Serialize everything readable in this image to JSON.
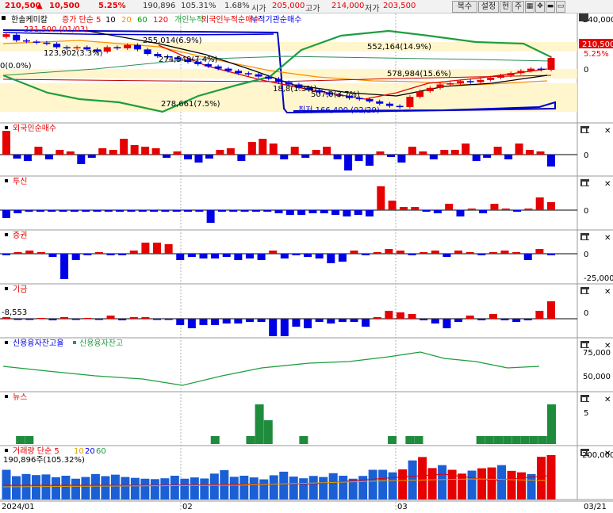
{
  "topbar": {
    "price": "210,500",
    "change_arrow": "▲",
    "change": "10,500",
    "change_pct": "5.25%",
    "volume": "190,896",
    "volume_ratio": "105.31%",
    "turnover": "1.68%",
    "open_label": "시가",
    "open": "205,000",
    "high_label": "고가",
    "high": "214,000",
    "low_label": "저가",
    "low": "203,500",
    "buttons": [
      "복수",
      "설정",
      "현",
      "주"
    ],
    "icon_buttons": [
      "grid-icon",
      "move-icon",
      "minimize-icon",
      "restore-icon"
    ]
  },
  "colors": {
    "up": "#e60000",
    "down": "#0000e6",
    "ma5": "#e60000",
    "ma10": "#000000",
    "ma20": "#ff8c00",
    "ma60": "#006400",
    "ma120": "#2e8b57",
    "bollinger": "#0000cc",
    "retail_cum": "#1e9e3e"
  },
  "main_panel": {
    "legend": [
      {
        "text": "한솔케미칼",
        "color": "#000000"
      },
      {
        "text": "증가 단순 5",
        "color": "#e60000"
      },
      {
        "text": "10",
        "color": "#000000"
      },
      {
        "text": "20",
        "color": "#ff8c00"
      },
      {
        "text": "60",
        "color": "#00a000"
      },
      {
        "text": "120",
        "color": "#e60000"
      },
      {
        "text": "개인누적",
        "color": "#1e9e3e"
      },
      {
        "text": "외국인누적순매수",
        "color": "#e60000"
      },
      {
        "text": "누적기관순매수",
        "color": "#0000e6"
      }
    ],
    "annotations": [
      {
        "text": "231,500 (01/03)",
        "color": "#e60000"
      },
      {
        "text": "123,902(3.3%)",
        "color": "#000000"
      },
      {
        "text": "255,014(6.9%)",
        "color": "#000000"
      },
      {
        "text": "274,549(7.4%)",
        "color": "#000000"
      },
      {
        "text": "278,661(7.5%)",
        "color": "#000000"
      },
      {
        "text": "552,164(14.9%)",
        "color": "#000000"
      },
      {
        "text": "578,984(15.6%)",
        "color": "#000000"
      },
      {
        "text": "507,0(3.7%)",
        "color": "#000000"
      },
      {
        "text": "최저 166,400 (02/29)",
        "color": "#0000e6"
      },
      {
        "text": "18,8(1.3%)",
        "color": "#000000"
      },
      {
        "text": "0(0.0%)",
        "color": "#000000"
      }
    ],
    "axis": {
      "top": "240,000",
      "zero": "0"
    },
    "price_badge": "210,500",
    "price_badge_pct": "5.25%"
  },
  "panels": [
    {
      "title": "외국인순매수",
      "axis": [
        "0"
      ]
    },
    {
      "title": "투신",
      "axis": [
        "0"
      ]
    },
    {
      "title": "증권",
      "axis": [
        "0",
        "-25,000"
      ]
    },
    {
      "title": "기금",
      "axis": [
        "0"
      ],
      "left_value": "-8,553"
    },
    {
      "title": "신용융자잔고율",
      "title2": "신용융자잔고",
      "axis": [
        "75,000",
        "50,000"
      ]
    },
    {
      "title": "뉴스",
      "axis": [
        "5"
      ]
    },
    {
      "title": "거래량 단순 5",
      "title_parts": [
        "10",
        "20",
        "60"
      ],
      "sub": "190,896주(105.32%)",
      "axis": [
        "200,000"
      ]
    }
  ],
  "x_axis": {
    "labels": [
      "2024/01",
      "02",
      "03"
    ],
    "right_label": "03/21"
  },
  "chart_data": {
    "type": "bar",
    "dates_note": "daily sessions, 2024/01 to 03/21",
    "candles": {
      "open": [
        229000,
        231000,
        226000,
        225000,
        224000,
        223000,
        220000,
        219000,
        220000,
        218000,
        216000,
        220000,
        219000,
        222000,
        218000,
        214000,
        212000,
        211000,
        209000,
        207000,
        205000,
        203000,
        201000,
        199000,
        197000,
        196000,
        194000,
        192000,
        189000,
        187000,
        184000,
        182000,
        180000,
        178000,
        177000,
        175000,
        174000,
        172000,
        170000,
        168000,
        167000,
        176000,
        181000,
        184000,
        187000,
        188000,
        190000,
        189000,
        191000,
        193000,
        195000,
        197000,
        199000,
        201000,
        200000
      ],
      "close": [
        231500,
        226000,
        225000,
        224000,
        223000,
        220000,
        219000,
        220000,
        218000,
        216000,
        220000,
        219000,
        222000,
        218000,
        214000,
        212000,
        211000,
        209000,
        207000,
        205000,
        203000,
        201000,
        199000,
        197000,
        196000,
        194000,
        192000,
        189000,
        187000,
        184000,
        182000,
        180000,
        178000,
        177000,
        175000,
        174000,
        172000,
        170000,
        168000,
        167000,
        176000,
        181000,
        184000,
        187000,
        188000,
        190000,
        189000,
        191000,
        193000,
        195000,
        197000,
        199000,
        201000,
        200000,
        210500
      ]
    },
    "series": [
      {
        "name": "외국인순매수",
        "values": [
          30,
          -5,
          -8,
          10,
          -6,
          6,
          4,
          -12,
          -4,
          8,
          6,
          20,
          12,
          10,
          8,
          -4,
          4,
          -6,
          -10,
          -5,
          6,
          8,
          -8,
          16,
          20,
          14,
          -6,
          10,
          -4,
          6,
          10,
          -6,
          -20,
          -8,
          -14,
          4,
          -3,
          -10,
          10,
          4,
          -6,
          6,
          6,
          14,
          -8,
          -4,
          10,
          -6,
          14,
          6,
          4,
          -15
        ]
      },
      {
        "name": "투신",
        "values": [
          -10,
          -4,
          -2,
          -2,
          -2,
          -2,
          -2,
          -2,
          -2,
          -2,
          -2,
          -2,
          -2,
          -2,
          -2,
          -2,
          -2,
          -2,
          -16,
          -2,
          -2,
          -2,
          -2,
          -2,
          -4,
          -6,
          -6,
          -4,
          -4,
          -6,
          -8,
          -6,
          -8,
          30,
          12,
          4,
          4,
          -2,
          -4,
          8,
          -8,
          2,
          -4,
          8,
          2,
          -2,
          2,
          16,
          10
        ]
      },
      {
        "name": "증권",
        "values": [
          -2,
          2,
          4,
          2,
          -4,
          -32,
          -8,
          -2,
          2,
          -2,
          -2,
          4,
          14,
          14,
          12,
          -8,
          -4,
          -6,
          -6,
          -4,
          -8,
          -6,
          -8,
          4,
          -6,
          -2,
          -4,
          -6,
          -12,
          -10,
          4,
          -2,
          2,
          6,
          4,
          -2,
          2,
          4,
          -4,
          4,
          2,
          -2,
          2,
          4,
          2,
          -8,
          6,
          -2
        ]
      },
      {
        "name": "기금",
        "values": [
          2,
          -1,
          -1,
          1,
          -2,
          2,
          -1,
          1,
          -1,
          4,
          -2,
          2,
          2,
          -1,
          -1,
          -8,
          -12,
          -8,
          -8,
          -6,
          -6,
          -4,
          -4,
          -22,
          -22,
          -10,
          -12,
          -4,
          -6,
          -4,
          -4,
          -10,
          2,
          10,
          8,
          6,
          -2,
          -6,
          -12,
          -4,
          4,
          -2,
          6,
          -2,
          -4,
          -2,
          10,
          22
        ]
      },
      {
        "name": "뉴스",
        "values": [
          0,
          1,
          1,
          0,
          0,
          0,
          0,
          0,
          0,
          0,
          0,
          0,
          0,
          0,
          0,
          0,
          0,
          0,
          0,
          0,
          0,
          0,
          0,
          1,
          0,
          0,
          0,
          1,
          5,
          3,
          0,
          0,
          0,
          1,
          0,
          0,
          0,
          0,
          0,
          0,
          0,
          0,
          0,
          1,
          0,
          1,
          1,
          0,
          0,
          0,
          0,
          0,
          0,
          1,
          1,
          1,
          1,
          1,
          1,
          1,
          1,
          5
        ]
      },
      {
        "name": "거래량",
        "values": [
          140000,
          110000,
          120000,
          115000,
          118000,
          105000,
          112000,
          98000,
          106000,
          120000,
          110000,
          117000,
          106000,
          102000,
          98000,
          96000,
          100000,
          112000,
          98000,
          104000,
          99000,
          122000,
          138000,
          107000,
          112000,
          104000,
          95000,
          114000,
          131000,
          108000,
          100000,
          111000,
          106000,
          124000,
          112000,
          98000,
          111000,
          140000,
          140000,
          128000,
          142000,
          184000,
          200000,
          148000,
          162000,
          140000,
          122000,
          136000,
          147000,
          151000,
          162000,
          135000,
          128000,
          120000,
          201000,
          209000
        ]
      }
    ]
  }
}
